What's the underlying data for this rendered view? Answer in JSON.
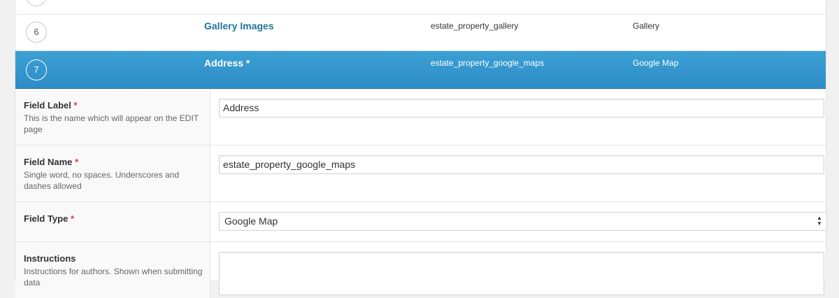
{
  "fields": [
    {
      "order": "6",
      "label": "Gallery Images",
      "name": "estate_property_gallery",
      "type": "Gallery"
    },
    {
      "order": "7",
      "label": "Address *",
      "name": "estate_property_google_maps",
      "type": "Google Map"
    }
  ],
  "settings": {
    "field_label": {
      "title": "Field Label",
      "required_mark": "*",
      "description": "This is the name which will appear on the EDIT page",
      "value": "Address"
    },
    "field_name": {
      "title": "Field Name",
      "required_mark": "*",
      "description": "Single word, no spaces. Underscores and dashes allowed",
      "value": "estate_property_google_maps"
    },
    "field_type": {
      "title": "Field Type",
      "required_mark": "*",
      "selected": "Google Map"
    },
    "instructions": {
      "title": "Instructions",
      "description": "Instructions for authors. Shown when submitting data",
      "value": ""
    }
  },
  "colors": {
    "active_row": "#2e8cc6",
    "link": "#21759b",
    "required": "#dd3d36"
  }
}
